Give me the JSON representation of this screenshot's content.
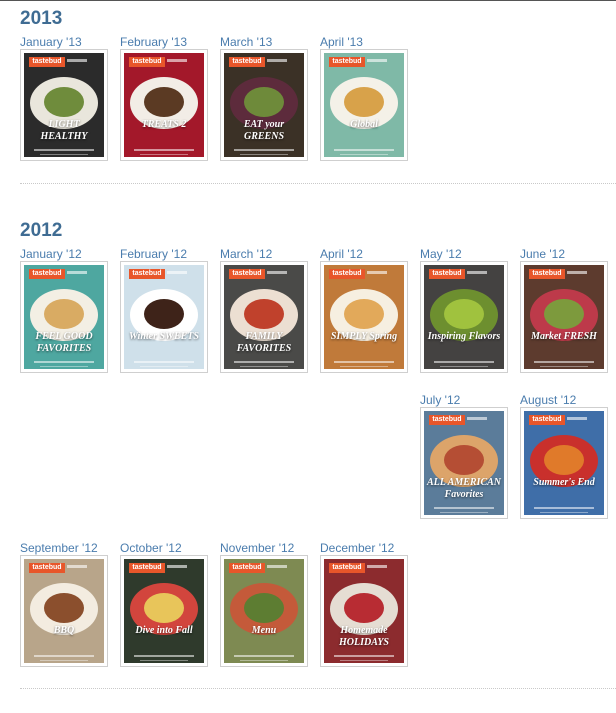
{
  "sections": [
    {
      "year": "2013",
      "issues": [
        {
          "label": "January '13",
          "bg": "#2b2b2b",
          "plate": "#e9e6dc",
          "food": "#6f8c3c",
          "title": "LIGHT HEALTHY",
          "titleColor": "#ffffff"
        },
        {
          "label": "February '13",
          "bg": "#a3182a",
          "plate": "#f2ede6",
          "food": "#5b3a23",
          "title": "TREATS 2",
          "titleColor": "#ffffff"
        },
        {
          "label": "March '13",
          "bg": "#3b3126",
          "plate": "#5d2b3c",
          "food": "#6e8a3a",
          "title": "EAT your GREENS",
          "titleColor": "#ffffff"
        },
        {
          "label": "April '13",
          "bg": "#7fb9a7",
          "plate": "#f4f1e8",
          "food": "#d8a24a",
          "title": "Global",
          "titleColor": "#ffffff"
        }
      ]
    },
    {
      "year": "2012",
      "issues": [
        {
          "label": "January '12",
          "bg": "#4ea7a0",
          "plate": "#f3efe4",
          "food": "#d9ab63",
          "title": "FEEL GOOD FAVORITES",
          "titleColor": "#ffffff"
        },
        {
          "label": "February '12",
          "bg": "#cfe0ea",
          "plate": "#ffffff",
          "food": "#3e2319",
          "title": "Winter SWEETS",
          "titleColor": "#ffffff"
        },
        {
          "label": "March '12",
          "bg": "#4a4a48",
          "plate": "#ecdfd2",
          "food": "#c0412c",
          "title": "FAMILY FAVORITES",
          "titleColor": "#ffffff"
        },
        {
          "label": "April '12",
          "bg": "#c07a3a",
          "plate": "#f6efe1",
          "food": "#e2a95a",
          "title": "SIMPLY Spring",
          "titleColor": "#ffffff"
        },
        {
          "label": "May '12",
          "bg": "#444241",
          "plate": "#6d8f2f",
          "food": "#a0c23e",
          "title": "Inspiring Flavors",
          "titleColor": "#ffffff"
        },
        {
          "label": "June '12",
          "bg": "#5d3b2e",
          "plate": "#bd3a4a",
          "food": "#7d9a3d",
          "title": "Market FRESH",
          "titleColor": "#ffffff"
        },
        {
          "label": "July '12",
          "bg": "#5b7c9a",
          "plate": "#dca46a",
          "food": "#b54e34",
          "title": "ALL AMERICAN Favorites",
          "titleColor": "#ffffff"
        },
        {
          "label": "August '12",
          "bg": "#3f6ea8",
          "plate": "#c9302c",
          "food": "#e07a2a",
          "title": "Summer's End",
          "titleColor": "#ffffff"
        },
        {
          "label": "September '12",
          "bg": "#b8a58a",
          "plate": "#f3ece0",
          "food": "#8b4f2d",
          "title": "BBQ",
          "titleColor": "#ffffff"
        },
        {
          "label": "October '12",
          "bg": "#2f3a2c",
          "plate": "#d2453d",
          "food": "#e8c55a",
          "title": "Dive into Fall",
          "titleColor": "#ffffff"
        },
        {
          "label": "November '12",
          "bg": "#7e8a52",
          "plate": "#c45a3a",
          "food": "#5d7d32",
          "title": "Menu",
          "titleColor": "#ffffff"
        },
        {
          "label": "December '12",
          "bg": "#8c2b2e",
          "plate": "#e5ddd3",
          "food": "#b82c33",
          "title": "Homemade HOLIDAYS",
          "titleColor": "#ffffff"
        }
      ]
    }
  ],
  "brand": "tastebud"
}
